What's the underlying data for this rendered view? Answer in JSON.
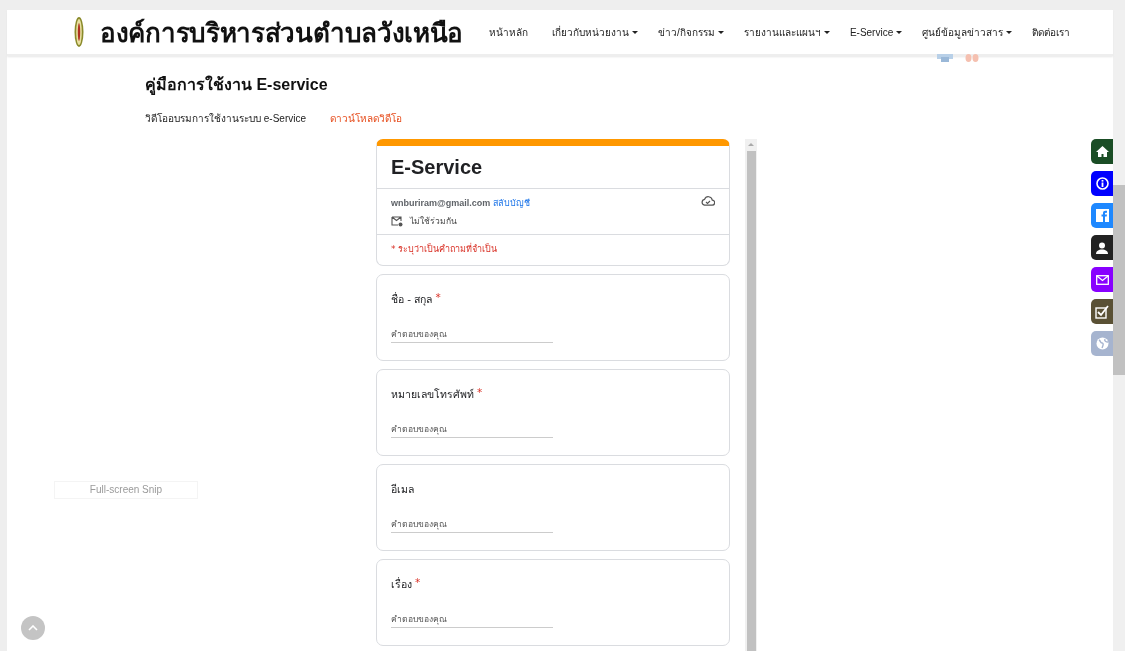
{
  "header": {
    "title": "องค์การบริหารส่วนตำบลวังเหนือ",
    "nav": [
      {
        "label": "หน้าหลัก",
        "dropdown": false
      },
      {
        "label": "เกี่ยวกับหน่วยงาน",
        "dropdown": true
      },
      {
        "label": "ข่าว/กิจกรรม",
        "dropdown": true
      },
      {
        "label": "รายงานและแผนฯ",
        "dropdown": true
      },
      {
        "label": "E-Service",
        "dropdown": true
      },
      {
        "label": "ศูนย์ข้อมูลข่าวสาร",
        "dropdown": true
      },
      {
        "label": "ติดต่อเรา",
        "dropdown": false
      }
    ]
  },
  "page": {
    "heading": "คู่มือการใช้งาน E-service",
    "video_label": "วิดีโออบรมการใช้งานระบบ e-Service",
    "download_link": "ดาวน์โหลดวิดีโอ"
  },
  "form": {
    "title": "E-Service",
    "account": "wnburiram@gmail.com",
    "switch_account": "สลับบัญชี",
    "not_shared": "ไม่ใช้ร่วมกัน",
    "required_note": "* ระบุว่าเป็นคำถามที่จำเป็น",
    "questions": [
      {
        "label": "ชื่อ - สกุล",
        "mark": "*",
        "placeholder": "คำตอบของคุณ"
      },
      {
        "label": "หมายเลขโทรศัพท์",
        "mark": "*",
        "placeholder": "คำตอบของคุณ"
      },
      {
        "label": "อีเมล",
        "placeholder": "คำตอบของคุณ"
      },
      {
        "label": "เรื่อง",
        "mark": "*",
        "placeholder": "คำตอบของคุณ"
      }
    ]
  },
  "side_buttons": [
    {
      "kind": "home",
      "color": "#1a4d25"
    },
    {
      "kind": "info",
      "color": "#0000ff"
    },
    {
      "kind": "facebook",
      "color": "#1e88ff"
    },
    {
      "kind": "user",
      "color": "#222222"
    },
    {
      "kind": "mail",
      "color": "#8800ff"
    },
    {
      "kind": "check",
      "color": "#5a5135"
    },
    {
      "kind": "globe",
      "color": "#a6b4cf"
    }
  ],
  "snip_overlay": "Full-screen Snip"
}
